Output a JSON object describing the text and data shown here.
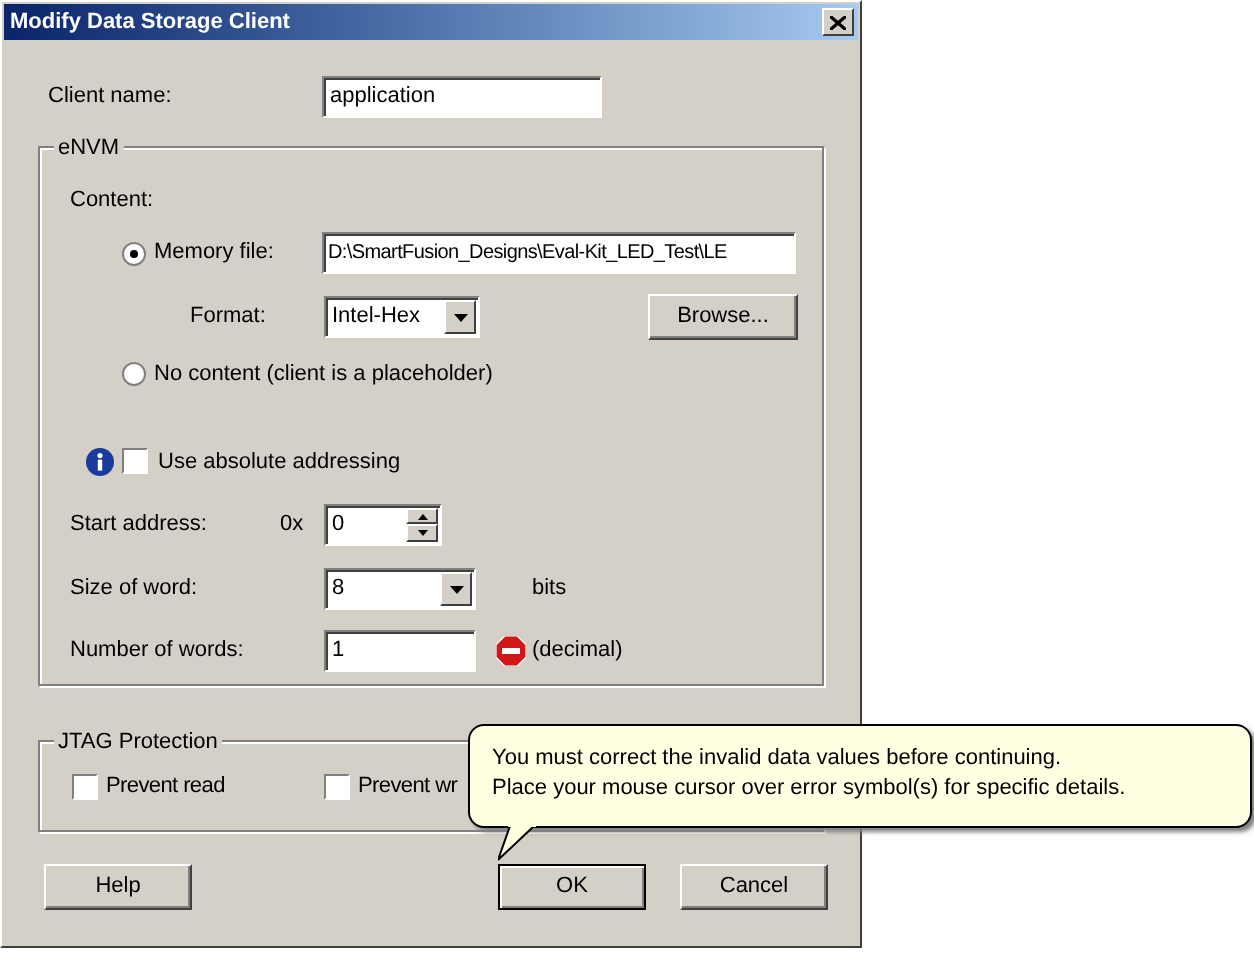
{
  "window": {
    "title": "Modify Data Storage Client"
  },
  "client_name": {
    "label": "Client name:",
    "value": "application"
  },
  "envm": {
    "title": "eNVM",
    "content_label": "Content:",
    "content_options": [
      {
        "kind": "file",
        "label": "Memory file:",
        "selected": true,
        "value": "D:\\SmartFusion_Designs\\Eval-Kit_LED_Test\\LE",
        "format_label": "Format:",
        "format_value": "Intel-Hex",
        "browse": "Browse..."
      },
      {
        "kind": "none",
        "label": "No content (client is a placeholder)",
        "selected": false
      }
    ],
    "absolute_addressing": {
      "label": "Use absolute addressing",
      "checked": false
    },
    "start_address": {
      "label": "Start address:",
      "prefix": "0x",
      "value": "0"
    },
    "word_size": {
      "label": "Size of word:",
      "value": "8",
      "unit": "bits"
    },
    "word_count": {
      "label": "Number of words:",
      "value": "1",
      "note": "(decimal)",
      "error": true
    }
  },
  "jtag": {
    "title": "JTAG Protection",
    "options": [
      {
        "label": "Prevent read",
        "checked": false
      },
      {
        "label": "Prevent wr",
        "checked": false
      }
    ]
  },
  "buttons": [
    {
      "label": "Help",
      "default": false
    },
    {
      "label": "OK",
      "default": true
    },
    {
      "label": "Cancel",
      "default": false
    }
  ],
  "tooltip": {
    "lines": [
      "You must correct the invalid data values before continuing.",
      "Place your mouse cursor over error symbol(s) for specific details."
    ]
  }
}
